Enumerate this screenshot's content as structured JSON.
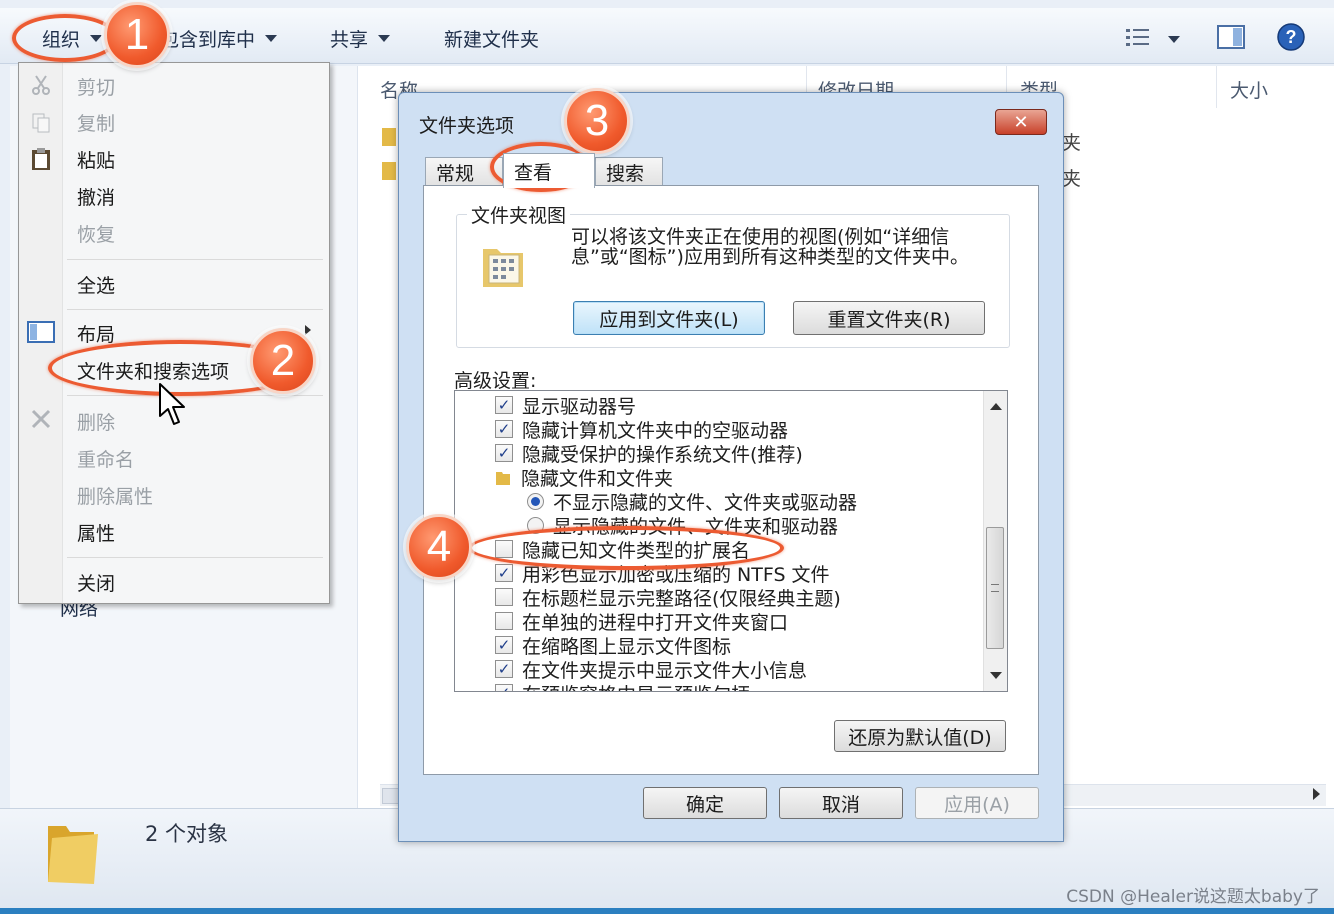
{
  "toolbar": {
    "organize": "组织",
    "include_library": "包含到库中",
    "share": "共享",
    "new_folder": "新建文件夹",
    "icons": [
      "view-list-icon",
      "preview-pane-icon",
      "help-icon"
    ]
  },
  "columns": {
    "name": "名称",
    "date_modified": "修改日期",
    "type": "类型",
    "size": "大小"
  },
  "file_rows_type": [
    "夹",
    "夹"
  ],
  "status": {
    "count": "2 个对象"
  },
  "nav": {
    "network": "网络"
  },
  "menu": {
    "cut": "剪切",
    "copy": "复制",
    "paste": "粘贴",
    "undo": "撤消",
    "redo": "恢复",
    "select_all": "全选",
    "layout": "布局",
    "folder_options": "文件夹和搜索选项",
    "delete": "删除",
    "rename": "重命名",
    "remove_properties": "删除属性",
    "properties": "属性",
    "close": "关闭"
  },
  "dialog": {
    "title": "文件夹选项",
    "close": "✕",
    "tabs": [
      "常规",
      "查看",
      "搜索"
    ],
    "active_tab": "查看",
    "folder_view": {
      "legend": "文件夹视图",
      "description": "可以将该文件夹正在使用的视图(例如“详细信息”或“图标”)应用到所有这种类型的文件夹中。",
      "apply_button": "应用到文件夹(L)",
      "reset_button": "重置文件夹(R)"
    },
    "advanced_label": "高级设置:",
    "settings": [
      {
        "label": "显示驱动器号",
        "kind": "checkbox",
        "checked": true
      },
      {
        "label": "隐藏计算机文件夹中的空驱动器",
        "kind": "checkbox",
        "checked": true
      },
      {
        "label": "隐藏受保护的操作系统文件(推荐)",
        "kind": "checkbox",
        "checked": true
      },
      {
        "label": "隐藏文件和文件夹",
        "kind": "folder"
      },
      {
        "label": "不显示隐藏的文件、文件夹或驱动器",
        "kind": "radio",
        "checked": true
      },
      {
        "label": "显示隐藏的文件、文件夹和驱动器",
        "kind": "radio",
        "checked": false
      },
      {
        "label": "隐藏已知文件类型的扩展名",
        "kind": "checkbox",
        "checked": false
      },
      {
        "label": "用彩色显示加密或压缩的 NTFS 文件",
        "kind": "checkbox",
        "checked": true
      },
      {
        "label": "在标题栏显示完整路径(仅限经典主题)",
        "kind": "checkbox",
        "checked": false
      },
      {
        "label": "在单独的进程中打开文件夹窗口",
        "kind": "checkbox",
        "checked": false
      },
      {
        "label": "在缩略图上显示文件图标",
        "kind": "checkbox",
        "checked": true
      },
      {
        "label": "在文件夹提示中显示文件大小信息",
        "kind": "checkbox",
        "checked": true
      },
      {
        "label": "在预览窗格中显示预览句柄",
        "kind": "checkbox",
        "checked": true
      }
    ],
    "restore_defaults": "还原为默认值(D)",
    "ok": "确定",
    "cancel": "取消",
    "apply": "应用(A)"
  },
  "annotations": [
    "1",
    "2",
    "3",
    "4"
  ],
  "colors": {
    "annotation": "#ec5b32",
    "accent": "#3c7fb1",
    "close_button": "#c8412a"
  },
  "watermark": "CSDN @Healer说这题太baby了"
}
